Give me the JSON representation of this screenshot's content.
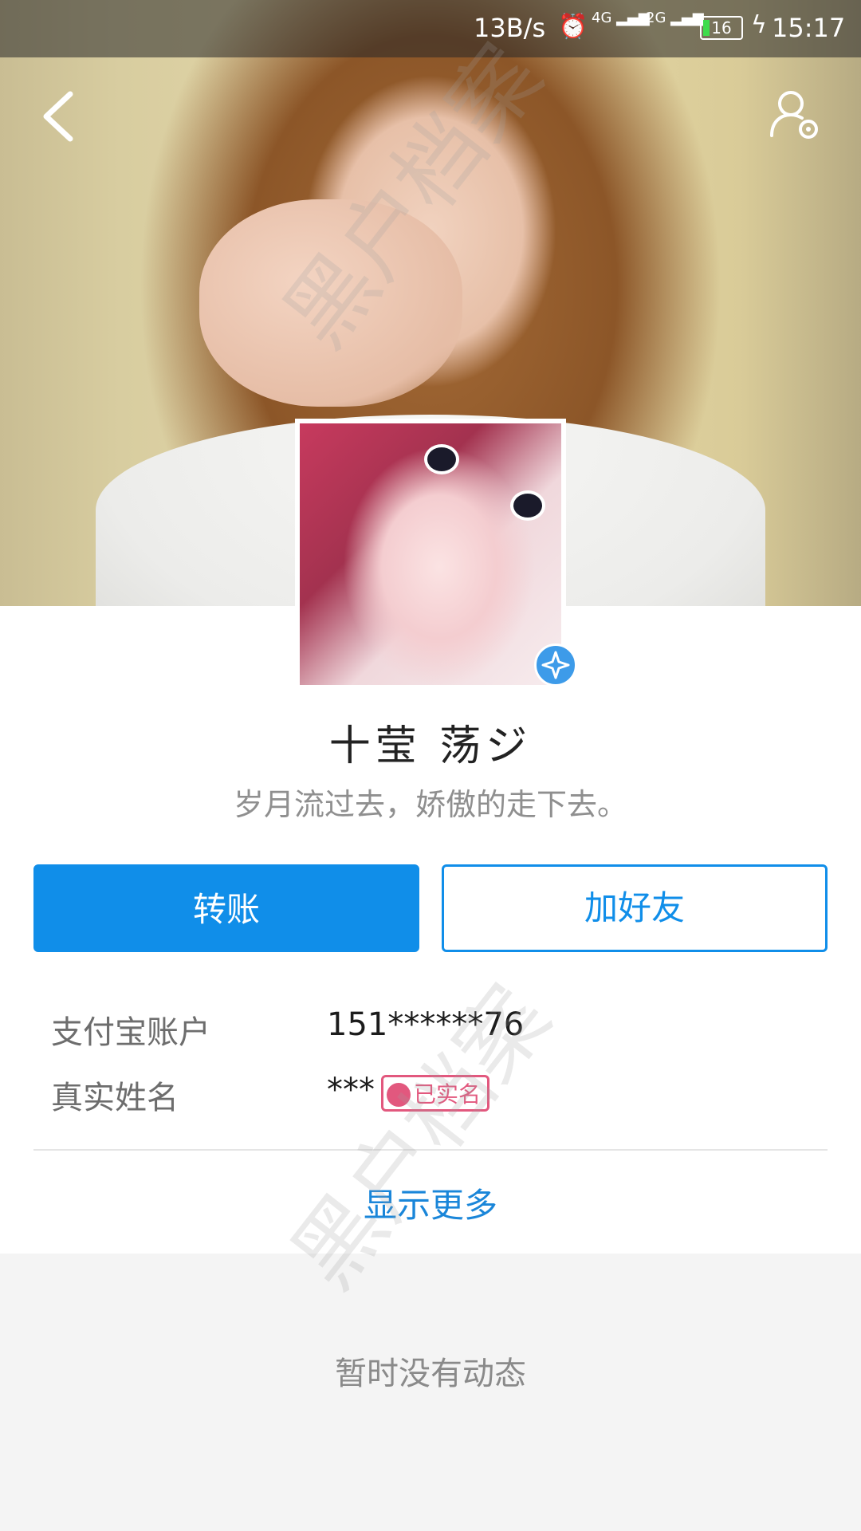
{
  "status_bar": {
    "net_speed": "13B/s",
    "signal1": "4G",
    "signal2": "2G",
    "battery": "16",
    "time": "15:17",
    "icons": [
      "alarm-icon",
      "signal-icon",
      "battery-icon",
      "charging-icon"
    ]
  },
  "toolbar": {
    "back_icon": "chevron-left-icon",
    "settings_icon": "user-settings-icon"
  },
  "profile": {
    "nickname": "十莹 荡ジ",
    "signature": "岁月流过去，娇傲的走下去。",
    "badge_icon": "star-badge-icon"
  },
  "actions": {
    "transfer_label": "转账",
    "add_friend_label": "加好友"
  },
  "info": {
    "account_label": "支付宝账户",
    "account_value": "151******76",
    "realname_label": "真实姓名",
    "realname_value": "***",
    "verified_label": "已实名"
  },
  "show_more_label": "显示更多",
  "feed": {
    "empty_text": "暂时没有动态"
  },
  "watermark_text": "黑户档案",
  "colors": {
    "accent": "#108ee9",
    "verified": "#e2587e",
    "feed_bg": "#f4f4f4"
  }
}
